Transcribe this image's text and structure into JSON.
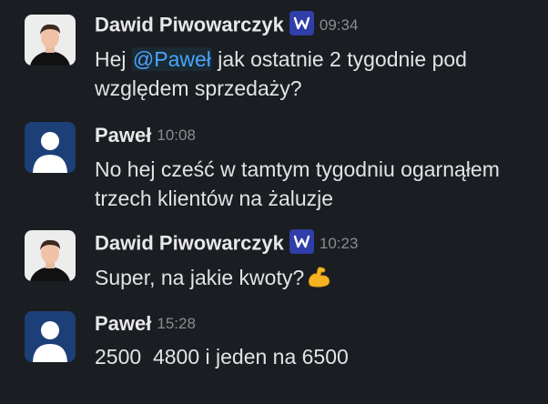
{
  "messages": [
    {
      "author": "Dawid Piwowarczyk",
      "badge": "W",
      "time": "09:34",
      "text_pre": "Hej ",
      "mention": "@Paweł",
      "text_post": " jak ostatnie 2 tygodnie pod względem sprzedaży?"
    },
    {
      "author": "Paweł",
      "time": "10:08",
      "text": "No hej cześć w tamtym tygodniu ogarnąłem trzech klientów na żaluzje"
    },
    {
      "author": "Dawid Piwowarczyk",
      "badge": "W",
      "time": "10:23",
      "text": "Super, na jakie kwoty?",
      "emoji": "flexed-biceps"
    },
    {
      "author": "Paweł",
      "time": "15:28",
      "text": "2500  4800 i jeden na 6500"
    }
  ],
  "colors": {
    "background": "#1a1d21",
    "mention": "#4aa3ff",
    "badge": "#2f3ea8",
    "default_avatar_bg": "#1d3f78",
    "default_avatar_fg": "#ffffff"
  }
}
